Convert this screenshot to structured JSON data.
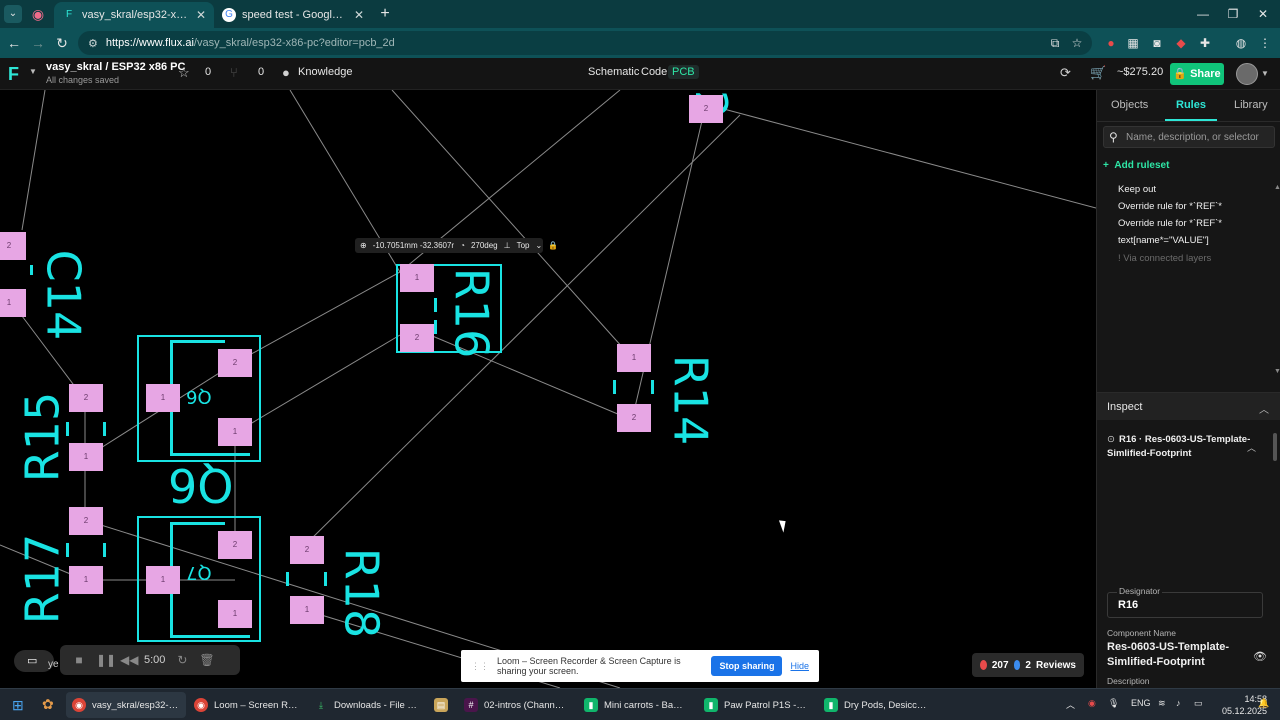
{
  "browser": {
    "tabs": [
      {
        "title": "vasy_skral/esp32-x86-pc: This is",
        "active": true,
        "favicon": "flux-icon"
      },
      {
        "title": "speed test - Google Search",
        "active": false,
        "favicon": "google-icon"
      }
    ],
    "url_host": "https://www.flux.ai",
    "url_path": "/vasy_skral/esp32-x86-pc?editor=pcb_2d"
  },
  "app": {
    "project_title": "vasy_skral / ESP32 x86 PC",
    "save_status": "All changes saved",
    "stars": "0",
    "forks": "0",
    "knowledge_label": "Knowledge",
    "modes": [
      "Schematic",
      "Code",
      "PCB"
    ],
    "active_mode": "PCB",
    "price": "~$275.20",
    "share_label": "Share"
  },
  "canvas": {
    "coord_readout": {
      "position": "-10.7051mm -32.3607r",
      "rotation": "270deg",
      "layer": "Top"
    },
    "refs": [
      "R16",
      "R14",
      "R15",
      "Q6",
      "R17",
      "Q7",
      "R18",
      "C14",
      "2"
    ],
    "pad_labels": {
      "one": "1",
      "two": "2"
    }
  },
  "loom": {
    "elapsed": "5:00",
    "peek_label": "ye",
    "share_message": "Loom – Screen Recorder & Screen Capture is sharing your screen.",
    "stop_label": "Stop sharing",
    "hide_label": "Hide"
  },
  "reviews": {
    "errors": "207",
    "infos": "2",
    "label": "Reviews"
  },
  "panel": {
    "tabs": [
      "Objects",
      "Rules",
      "Library"
    ],
    "active_tab": "Rules",
    "search_placeholder": "Name, description, or selector",
    "add_ruleset_label": "Add ruleset",
    "rules": [
      {
        "label": "Keep out",
        "dim": false
      },
      {
        "label": "Override rule for *`REF`*",
        "dim": false
      },
      {
        "label": "Override rule for *`REF`*",
        "dim": false
      },
      {
        "label": "text[name*=\"VALUE\"]",
        "dim": false
      },
      {
        "label": "! Via connected layers",
        "dim": true
      }
    ],
    "inspect_title": "Inspect",
    "inspect_item": "R16 · Res-0603-US-Template-Simlified-Footprint",
    "designator_label": "Designator",
    "designator_value": "R16",
    "component_name_label": "Component Name",
    "component_name_value": "Res-0603-US-Template-Simlified-Footprint",
    "description_label": "Description"
  },
  "taskbar": {
    "apps": [
      {
        "label": "vasy_skral/esp32-x86-pc",
        "icon": "chrome-icon",
        "active": true
      },
      {
        "label": "Loom – Screen Recorde",
        "icon": "chrome-icon",
        "active": false
      },
      {
        "label": "Downloads - File Explor",
        "icon": "download-icon",
        "active": false
      },
      {
        "label": "",
        "icon": "notepad-icon",
        "active": false
      },
      {
        "label": "02-intros (Channel) - Flu",
        "icon": "slack-icon",
        "active": false
      },
      {
        "label": "Mini carrots - BambuStu",
        "icon": "bambu-icon",
        "active": false
      },
      {
        "label": "Paw Patrol P1S - Bambu",
        "icon": "bambu-icon",
        "active": false
      },
      {
        "label": "Dry Pods, Desiccant Tray",
        "icon": "bambu-icon",
        "active": false
      }
    ],
    "language": "ENG",
    "time": "14:58",
    "date": "05.12.2025"
  },
  "colors": {
    "accent": "#2ee6d6",
    "silkscreen": "#19e3e3",
    "pad": "#e7a6e4",
    "share": "#10c47a"
  }
}
